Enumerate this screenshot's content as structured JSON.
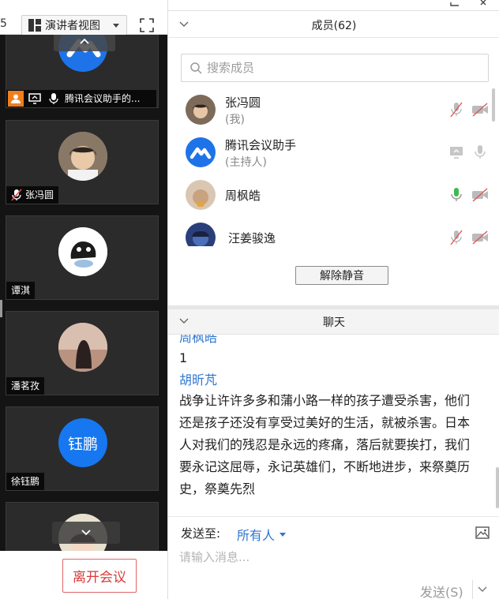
{
  "left_panel": {
    "cut_label": "5",
    "view_mode": "演讲者视图",
    "tiles": [
      {
        "name": "腾讯会议助手的..."
      },
      {
        "name": "张冯圆"
      },
      {
        "name": "谭淇"
      },
      {
        "name": "潘茗孜"
      },
      {
        "name": "徐钰鹏",
        "avatar_text": "钰鹏"
      }
    ],
    "leave_button": "离开会议"
  },
  "members": {
    "title": "成员(62)",
    "search_placeholder": "搜索成员",
    "list": [
      {
        "name": "张冯圆",
        "role": "(我)"
      },
      {
        "name": "腾讯会议助手",
        "role": "(主持人)"
      },
      {
        "name": "周枫皓"
      },
      {
        "name": "汪姜骏逸"
      }
    ],
    "unmute_button": "解除静音"
  },
  "chat": {
    "title": "聊天",
    "messages": [
      {
        "sender": "周枫皓",
        "text": "1"
      },
      {
        "sender": "胡昕芃",
        "lines": [
          "战争让许许多多和蒲小路一样的孩子遭受杀害，他们",
          "还是孩子还没有享受过美好的生活，就被杀害。日本",
          "人对我们的残忍是永远的疼痛，落后就要挨打，我们",
          "要永记这屈辱，永记英雄们，不断地进步，来祭奠历",
          "史，祭奠先烈"
        ]
      }
    ],
    "send_to_label": "发送至:",
    "send_target": "所有人",
    "input_placeholder": "请输入消息...",
    "send_button": "发送(S)"
  },
  "colors": {
    "accent": "#2f76d2",
    "danger": "#d93b3b",
    "active_mic": "#3fb950",
    "video_bg": "#141414"
  }
}
